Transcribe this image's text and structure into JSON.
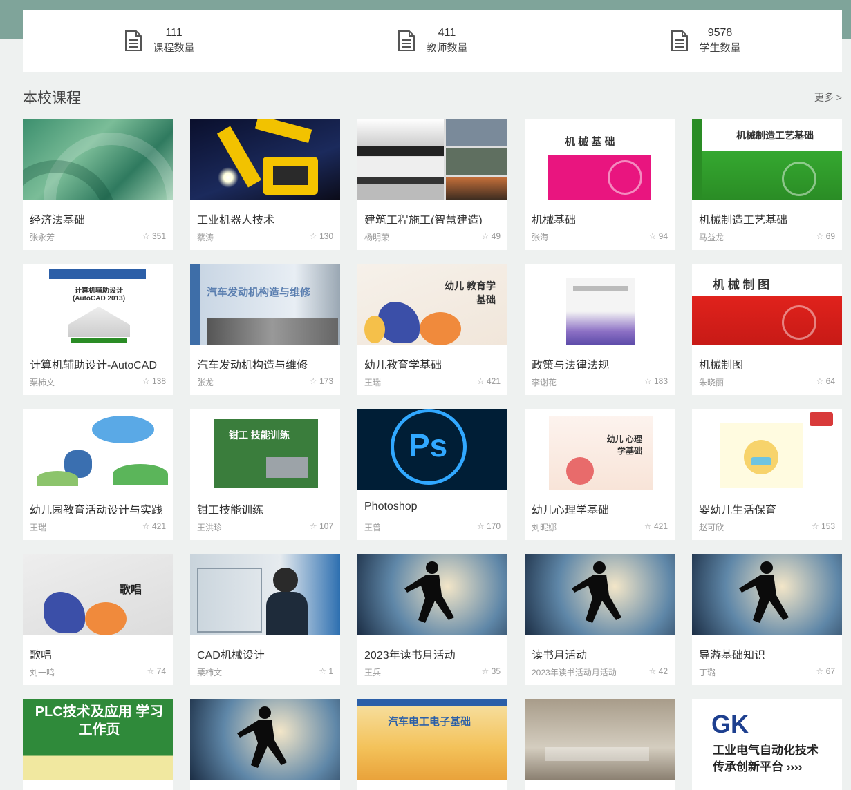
{
  "stats": [
    {
      "value": "111",
      "label": "课程数量",
      "icon": "document-icon"
    },
    {
      "value": "411",
      "label": "教师数量",
      "icon": "document-icon"
    },
    {
      "value": "9578",
      "label": "学生数量",
      "icon": "document-icon"
    }
  ],
  "section": {
    "title": "本校课程",
    "more": "更多 >"
  },
  "courses": [
    {
      "title": "经济法基础",
      "teacher": "张永芳",
      "stars": "351"
    },
    {
      "title": "工业机器人技术",
      "teacher": "蔡涛",
      "stars": "130"
    },
    {
      "title": "建筑工程施工(智慧建造)",
      "teacher": "杨明荣",
      "stars": "49"
    },
    {
      "title": "机械基础",
      "teacher": "张海",
      "stars": "94"
    },
    {
      "title": "机械制造工艺基础",
      "teacher": "马益龙",
      "stars": "69"
    },
    {
      "title": "计算机辅助设计-AutoCAD",
      "teacher": "粟柿文",
      "stars": "138"
    },
    {
      "title": "汽车发动机构造与维修",
      "teacher": "张龙",
      "stars": "173"
    },
    {
      "title": "幼儿教育学基础",
      "teacher": "王瑞",
      "stars": "421"
    },
    {
      "title": "政策与法律法规",
      "teacher": "李谢花",
      "stars": "183"
    },
    {
      "title": "机械制图",
      "teacher": "朱晓丽",
      "stars": "64"
    },
    {
      "title": "幼儿园教育活动设计与实践",
      "teacher": "王瑞",
      "stars": "421"
    },
    {
      "title": "钳工技能训练",
      "teacher": "王洪珍",
      "stars": "107"
    },
    {
      "title": "Photoshop",
      "teacher": "王曾",
      "stars": "170"
    },
    {
      "title": "幼儿心理学基础",
      "teacher": "刘昵娜",
      "stars": "421"
    },
    {
      "title": "婴幼儿生活保育",
      "teacher": "赵可欣",
      "stars": "153"
    },
    {
      "title": "歌唱",
      "teacher": "刘一鸣",
      "stars": "74"
    },
    {
      "title": "CAD机械设计",
      "teacher": "粟柿文",
      "stars": "1"
    },
    {
      "title": "2023年读书月活动",
      "teacher": "王兵",
      "stars": "35"
    },
    {
      "title": "读书月活动",
      "teacher": "2023年读书活动月活动",
      "stars": "42"
    },
    {
      "title": "导游基础知识",
      "teacher": "丁璐",
      "stars": "67"
    }
  ],
  "thumb_text": {
    "jixie_jichu": "机 械 基 础",
    "jixie_zhizao": "机械制造工艺基础",
    "autocad": "计算机辅助设计 (AutoCAD 2013)",
    "engine": "汽车发动机构造与维修",
    "youer": "幼儿 教育学基础",
    "zhitu": "机 械 制 图",
    "qiangong": "钳工 技能训练",
    "ps": "Ps",
    "youer_xinli": "幼儿 心理学基础",
    "gechang": "歌唱",
    "plc": "PLC技术及应用 学习工作页",
    "qiche_dian": "汽车电工电子基础",
    "gk_logo": "GK",
    "gk_line1": "工业电气自动化技术",
    "gk_line2": "传承创新平台 ››››"
  },
  "colors": {
    "header_band": "#7fa49a",
    "page_bg": "#eef1f0",
    "ps_blue": "#31a8ff",
    "ps_bg": "#001e36"
  }
}
